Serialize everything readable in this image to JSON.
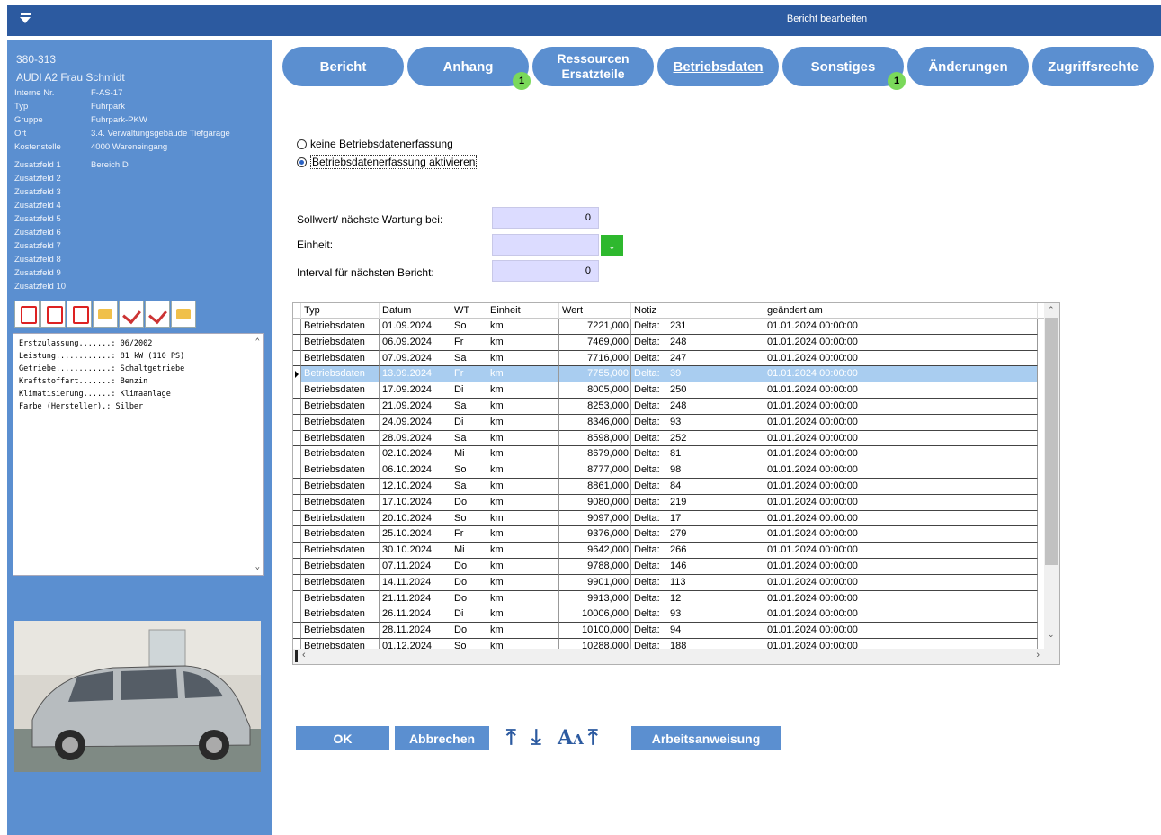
{
  "window": {
    "title": "Bericht bearbeiten"
  },
  "sidebar": {
    "number": "380-313",
    "name": "AUDI A2 Frau Schmidt",
    "props": [
      {
        "key": "Interne Nr.",
        "value": "F-AS-17"
      },
      {
        "key": "Typ",
        "value": "Fuhrpark"
      },
      {
        "key": "Gruppe",
        "value": "Fuhrpark-PKW"
      },
      {
        "key": "Ort",
        "value": "3.4. Verwaltungsgebäude Tiefgarage"
      },
      {
        "key": "Kostenstelle",
        "value": "4000 Wareneingang"
      }
    ],
    "extra_fields": [
      {
        "key": "Zusatzfeld 1",
        "value": "Bereich D"
      },
      {
        "key": "Zusatzfeld 2",
        "value": ""
      },
      {
        "key": "Zusatzfeld 3",
        "value": ""
      },
      {
        "key": "Zusatzfeld 4",
        "value": ""
      },
      {
        "key": "Zusatzfeld 5",
        "value": ""
      },
      {
        "key": "Zusatzfeld 6",
        "value": ""
      },
      {
        "key": "Zusatzfeld 7",
        "value": ""
      },
      {
        "key": "Zusatzfeld 8",
        "value": ""
      },
      {
        "key": "Zusatzfeld 9",
        "value": ""
      },
      {
        "key": "Zusatzfeld 10",
        "value": ""
      }
    ],
    "doc_icons": [
      "pdf-icon",
      "pdf-icon",
      "pdf-icon",
      "document-badge-icon",
      "check-document-icon",
      "check-document-icon",
      "document-badge-icon"
    ],
    "specs": [
      "Erstzulassung.......: 06/2002",
      "Leistung............: 81 kW (110 PS)",
      "Getriebe............: Schaltgetriebe",
      "Kraftstoffart.......: Benzin",
      "Klimatisierung......: Klimaanlage",
      "Farbe (Hersteller).: Silber"
    ]
  },
  "tabs": [
    {
      "label": "Bericht",
      "badge": ""
    },
    {
      "label": "Anhang",
      "badge": "1"
    },
    {
      "label": "Ressourcen Ersatzteile",
      "badge": ""
    },
    {
      "label": "Betriebsdaten",
      "badge": ""
    },
    {
      "label": "Sonstiges",
      "badge": "1"
    },
    {
      "label": "Änderungen",
      "badge": ""
    },
    {
      "label": "Zugriffsrechte",
      "badge": ""
    }
  ],
  "active_tab": "Betriebsdaten",
  "radios": {
    "none_label": "keine Betriebsdatenerfassung",
    "active_label": "Betriebsdatenerfassung aktivieren",
    "selected": "active"
  },
  "form": {
    "target_label": "Sollwert/ nächste Wartung bei:",
    "target_value": "0",
    "unit_label": "Einheit:",
    "unit_value": "",
    "interval_label": "Interval für nächsten Bericht:",
    "interval_value": "0"
  },
  "grid": {
    "columns": [
      "Typ",
      "Datum",
      "WT",
      "Einheit",
      "Wert",
      "Notiz",
      "geändert am"
    ],
    "selected_index": 3,
    "rows": [
      [
        "Betriebsdaten",
        "01.09.2024",
        "So",
        "km",
        "7221,000",
        "Delta:",
        "231",
        "01.01.2024 00:00:00"
      ],
      [
        "Betriebsdaten",
        "06.09.2024",
        "Fr",
        "km",
        "7469,000",
        "Delta:",
        "248",
        "01.01.2024 00:00:00"
      ],
      [
        "Betriebsdaten",
        "07.09.2024",
        "Sa",
        "km",
        "7716,000",
        "Delta:",
        "247",
        "01.01.2024 00:00:00"
      ],
      [
        "Betriebsdaten",
        "13.09.2024",
        "Fr",
        "km",
        "7755,000",
        "Delta:",
        "39",
        "01.01.2024 00:00:00"
      ],
      [
        "Betriebsdaten",
        "17.09.2024",
        "Di",
        "km",
        "8005,000",
        "Delta:",
        "250",
        "01.01.2024 00:00:00"
      ],
      [
        "Betriebsdaten",
        "21.09.2024",
        "Sa",
        "km",
        "8253,000",
        "Delta:",
        "248",
        "01.01.2024 00:00:00"
      ],
      [
        "Betriebsdaten",
        "24.09.2024",
        "Di",
        "km",
        "8346,000",
        "Delta:",
        "93",
        "01.01.2024 00:00:00"
      ],
      [
        "Betriebsdaten",
        "28.09.2024",
        "Sa",
        "km",
        "8598,000",
        "Delta:",
        "252",
        "01.01.2024 00:00:00"
      ],
      [
        "Betriebsdaten",
        "02.10.2024",
        "Mi",
        "km",
        "8679,000",
        "Delta:",
        "81",
        "01.01.2024 00:00:00"
      ],
      [
        "Betriebsdaten",
        "06.10.2024",
        "So",
        "km",
        "8777,000",
        "Delta:",
        "98",
        "01.01.2024 00:00:00"
      ],
      [
        "Betriebsdaten",
        "12.10.2024",
        "Sa",
        "km",
        "8861,000",
        "Delta:",
        "84",
        "01.01.2024 00:00:00"
      ],
      [
        "Betriebsdaten",
        "17.10.2024",
        "Do",
        "km",
        "9080,000",
        "Delta:",
        "219",
        "01.01.2024 00:00:00"
      ],
      [
        "Betriebsdaten",
        "20.10.2024",
        "So",
        "km",
        "9097,000",
        "Delta:",
        "17",
        "01.01.2024 00:00:00"
      ],
      [
        "Betriebsdaten",
        "25.10.2024",
        "Fr",
        "km",
        "9376,000",
        "Delta:",
        "279",
        "01.01.2024 00:00:00"
      ],
      [
        "Betriebsdaten",
        "30.10.2024",
        "Mi",
        "km",
        "9642,000",
        "Delta:",
        "266",
        "01.01.2024 00:00:00"
      ],
      [
        "Betriebsdaten",
        "07.11.2024",
        "Do",
        "km",
        "9788,000",
        "Delta:",
        "146",
        "01.01.2024 00:00:00"
      ],
      [
        "Betriebsdaten",
        "14.11.2024",
        "Do",
        "km",
        "9901,000",
        "Delta:",
        "113",
        "01.01.2024 00:00:00"
      ],
      [
        "Betriebsdaten",
        "21.11.2024",
        "Do",
        "km",
        "9913,000",
        "Delta:",
        "12",
        "01.01.2024 00:00:00"
      ],
      [
        "Betriebsdaten",
        "26.11.2024",
        "Di",
        "km",
        "10006,000",
        "Delta:",
        "93",
        "01.01.2024 00:00:00"
      ],
      [
        "Betriebsdaten",
        "28.11.2024",
        "Do",
        "km",
        "10100,000",
        "Delta:",
        "94",
        "01.01.2024 00:00:00"
      ],
      [
        "Betriebsdaten",
        "01.12.2024",
        "So",
        "km",
        "10288,000",
        "Delta:",
        "188",
        "01.01.2024 00:00:00"
      ]
    ]
  },
  "buttons": {
    "ok": "OK",
    "cancel": "Abbrechen",
    "work_instruction": "Arbeitsanweisung"
  },
  "toolbar_icons": [
    "upload-icon",
    "download-icon",
    "font-size-icon",
    "upload-icon"
  ],
  "colors": {
    "titlebar": "#2c5aa0",
    "accent": "#5b8fd0",
    "badge": "#7ad95a",
    "selected_row": "#a9cdf0",
    "input_bg": "#dcdcff",
    "dropdown_button": "#2eb82e"
  }
}
